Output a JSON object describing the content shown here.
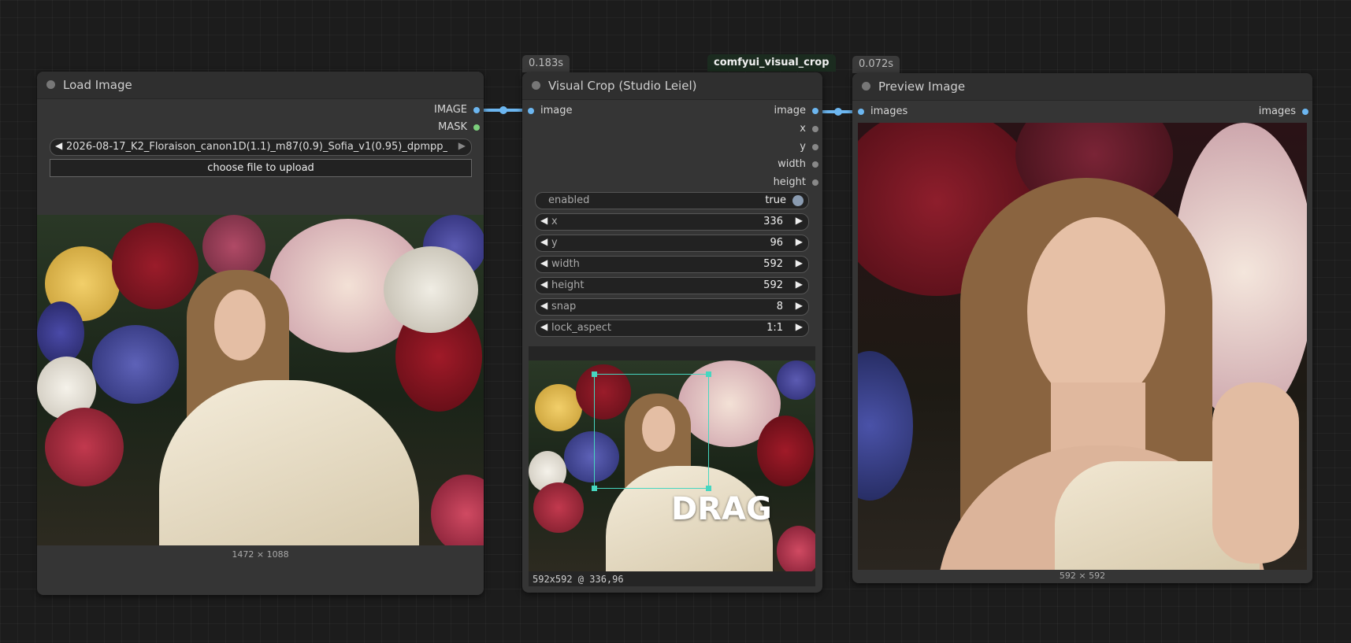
{
  "nodes": {
    "load_image": {
      "title": "Load Image",
      "outputs": [
        "IMAGE",
        "MASK"
      ],
      "file_value": "2026-08-17_K2_Floraison_canon1D(1.1)_m87(0.9)_Sofia_v1(0.95)_dpmpp_...",
      "upload_label": "choose file to upload",
      "image_caption": "1472 × 1088"
    },
    "visual_crop": {
      "title": "Visual Crop (Studio Leiel)",
      "time_badge": "0.183s",
      "package_badge": "comfyui_visual_crop",
      "input": "image",
      "outputs": [
        "image",
        "x",
        "y",
        "width",
        "height"
      ],
      "widgets": {
        "enabled": {
          "label": "enabled",
          "value": "true"
        },
        "x": {
          "label": "x",
          "value": "336"
        },
        "y": {
          "label": "y",
          "value": "96"
        },
        "width": {
          "label": "width",
          "value": "592"
        },
        "height": {
          "label": "height",
          "value": "592"
        },
        "snap": {
          "label": "snap",
          "value": "8"
        },
        "lock_aspect": {
          "label": "lock_aspect",
          "value": "1:1"
        }
      },
      "drag_label": "DRAG",
      "status": "592x592 @ 336,96"
    },
    "preview_image": {
      "title": "Preview Image",
      "time_badge": "0.072s",
      "input": "images",
      "output": "images",
      "image_caption": "592 × 592"
    }
  },
  "colors": {
    "wire_image": "#6cb6f0",
    "mask_slot": "#7ccf7c",
    "crop_box": "#46d6c0"
  }
}
